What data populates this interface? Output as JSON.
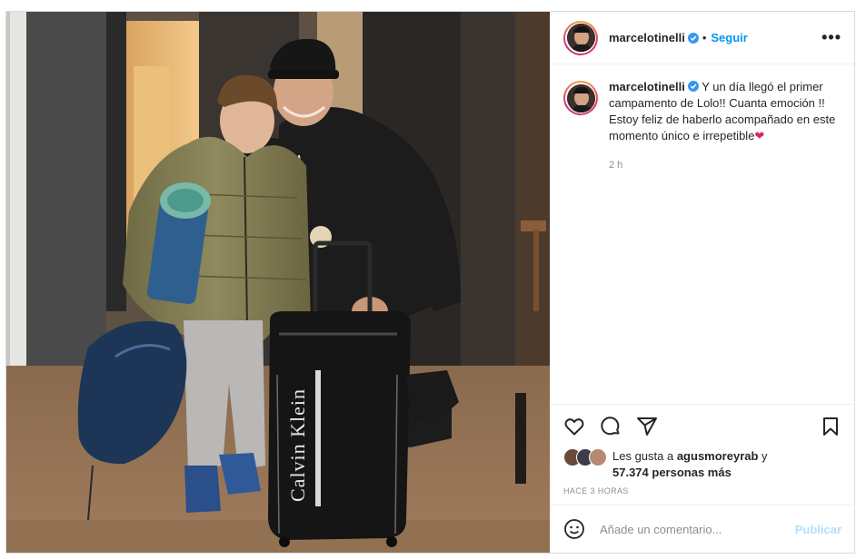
{
  "post": {
    "author": {
      "username": "marcelotinelli",
      "verified": true,
      "follow_label": "Seguir",
      "separator": "•",
      "more_label": "•••"
    },
    "caption": {
      "username": "marcelotinelli",
      "text": " Y un día llegó el primer campamento de Lolo!! Cuanta emoción !! Estoy feliz de haberlo acompañado en este momento único e irrepetible",
      "emoji": "❤",
      "time": "2 h"
    },
    "actions": {
      "like_icon": "heart-outline-icon",
      "comment_icon": "comment-bubble-icon",
      "share_icon": "paper-plane-icon",
      "save_icon": "bookmark-icon"
    },
    "likes": {
      "prefix": "Les gusta a ",
      "first_user": "agusmoreyrab",
      "connector": " y",
      "others": "57.374 personas más"
    },
    "posted_ago": "HACE 3 HORAS",
    "comment_box": {
      "placeholder": "Añade un comentario...",
      "publish_label": "Publicar"
    },
    "photo": {
      "luggage_brand": "Calvin Klein"
    },
    "colors": {
      "link_blue": "#0095f6",
      "publish_disabled": "#b2dffc",
      "verified_blue": "#3897f0",
      "heart_red": "#e0245e"
    }
  }
}
